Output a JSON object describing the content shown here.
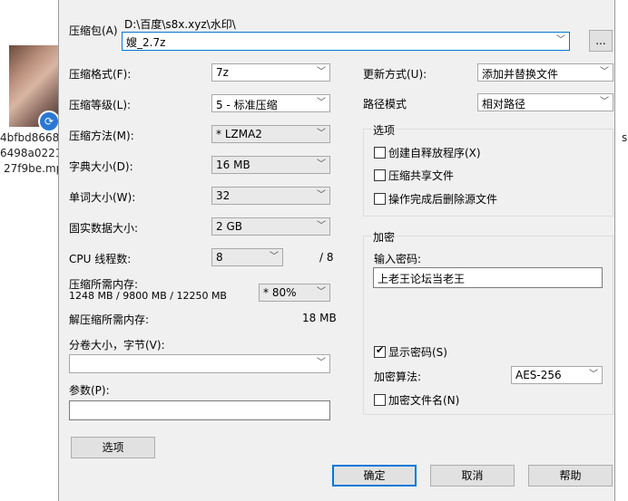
{
  "background": {
    "file_name_lines": [
      "4bfbd8668",
      "6498a0221",
      "27f9be.mp"
    ],
    "right_edge_text": "s"
  },
  "archive": {
    "label": "压缩包(A)",
    "path": "D:\\百度\\s8x.xyz\\水印\\",
    "value": "嫂_2.7z",
    "browse_label": "..."
  },
  "left": {
    "format": {
      "label": "压缩格式(F):",
      "value": "7z"
    },
    "level": {
      "label": "压缩等级(L):",
      "value": "5 - 标准压缩"
    },
    "method": {
      "label": "压缩方法(M):",
      "value": "* LZMA2"
    },
    "dict": {
      "label": "字典大小(D):",
      "value": "16 MB"
    },
    "word": {
      "label": "单词大小(W):",
      "value": "32"
    },
    "solid": {
      "label": "固实数据大小:",
      "value": "2 GB"
    },
    "cpu": {
      "label": "CPU 线程数:",
      "value": "8",
      "total": "/ 8"
    },
    "mem_compress": {
      "label": "压缩所需内存:",
      "detail": "1248 MB / 9800 MB / 12250 MB",
      "value": "* 80%"
    },
    "mem_decompress": {
      "label": "解压缩所需内存:",
      "value": "18 MB"
    },
    "split": {
      "label": "分卷大小，字节(V):",
      "value": ""
    },
    "params": {
      "label": "参数(P):",
      "value": ""
    },
    "options_button": "选项"
  },
  "right": {
    "update": {
      "label": "更新方式(U):",
      "value": "添加并替换文件"
    },
    "path_mode": {
      "label": "路径模式",
      "value": "相对路径"
    },
    "options_group": {
      "title": "选项",
      "items": [
        {
          "label": "创建自释放程序(X)",
          "checked": false
        },
        {
          "label": "压缩共享文件",
          "checked": false
        },
        {
          "label": "操作完成后删除源文件",
          "checked": false
        }
      ]
    },
    "encryption": {
      "title": "加密",
      "password_label": "输入密码:",
      "password_value": "上老王论坛当老王",
      "show_password": {
        "label": "显示密码(S)",
        "checked": true
      },
      "algo_label": "加密算法:",
      "algo_value": "AES-256",
      "encrypt_names": {
        "label": "加密文件名(N)",
        "checked": false
      }
    }
  },
  "buttons": {
    "ok": "确定",
    "cancel": "取消",
    "help": "帮助"
  },
  "icons": {
    "dropdown": "chevron-down-icon",
    "check": "check-icon"
  }
}
